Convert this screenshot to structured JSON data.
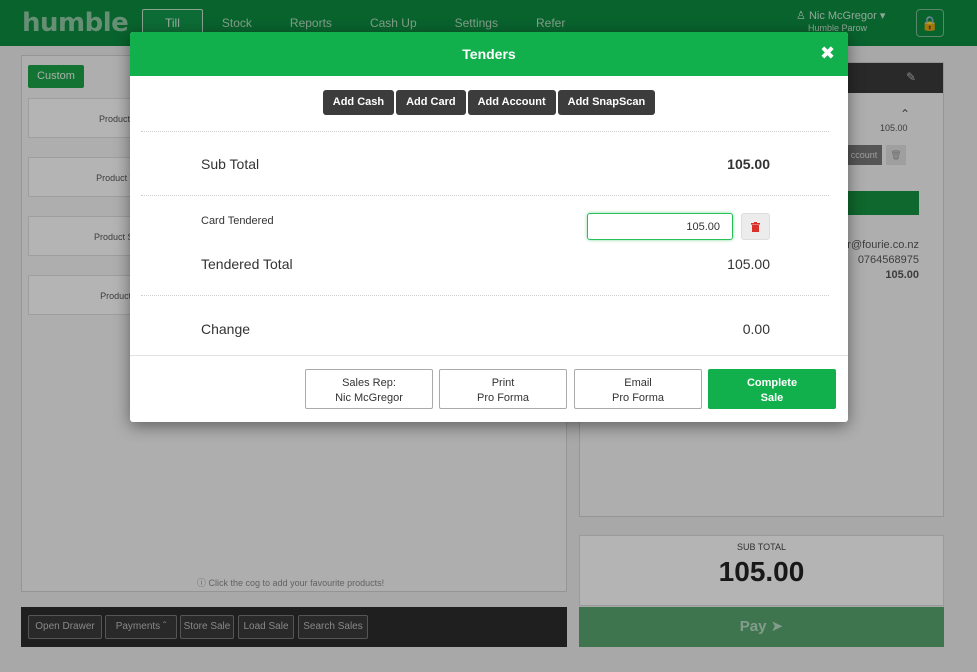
{
  "app": {
    "logo": "humble",
    "nav": [
      "Till",
      "Stock",
      "Reports",
      "Cash Up",
      "Settings",
      "Refer"
    ],
    "active_nav": "Till",
    "user_name": "Nic McGregor",
    "store_name": "Humble Parow"
  },
  "products": {
    "custom_label": "Custom",
    "items": [
      "Product Fo",
      "Product Thr",
      "Product Sev",
      "Product Te"
    ],
    "hint": "Click the cog to add your favourite products!"
  },
  "bottom_bar": {
    "buttons": [
      "Open Drawer",
      "Payments",
      "Store Sale",
      "Load Sale",
      "Search Sales"
    ]
  },
  "cart": {
    "item_price": "105.00",
    "account_label": "ccount",
    "contact_email": "r@fourie.co.nz",
    "contact_phone": "0764568975",
    "contact_total": "105.00"
  },
  "summary": {
    "subtotal_label": "SUB TOTAL",
    "subtotal_value": "105.00",
    "pay_label": "Pay"
  },
  "modal": {
    "title": "Tenders",
    "add_buttons": [
      "Add Cash",
      "Add Card",
      "Add Account",
      "Add SnapScan"
    ],
    "sub_total_label": "Sub Total",
    "sub_total_value": "105.00",
    "card_tendered_label": "Card Tendered",
    "card_tendered_value": "105.00",
    "tendered_total_label": "Tendered Total",
    "tendered_total_value": "105.00",
    "change_label": "Change",
    "change_value": "0.00",
    "footer": {
      "sales_rep_line1": "Sales Rep:",
      "sales_rep_line2": "Nic McGregor",
      "print_line1": "Print",
      "print_line2": "Pro Forma",
      "email_line1": "Email",
      "email_line2": "Pro Forma",
      "complete_line1": "Complete",
      "complete_line2": "Sale"
    }
  },
  "colors": {
    "brand_green": "#12b04c",
    "nav_green": "#0d8a3f",
    "dark_button": "#3c3c3c",
    "delete_red": "#d9302c"
  }
}
